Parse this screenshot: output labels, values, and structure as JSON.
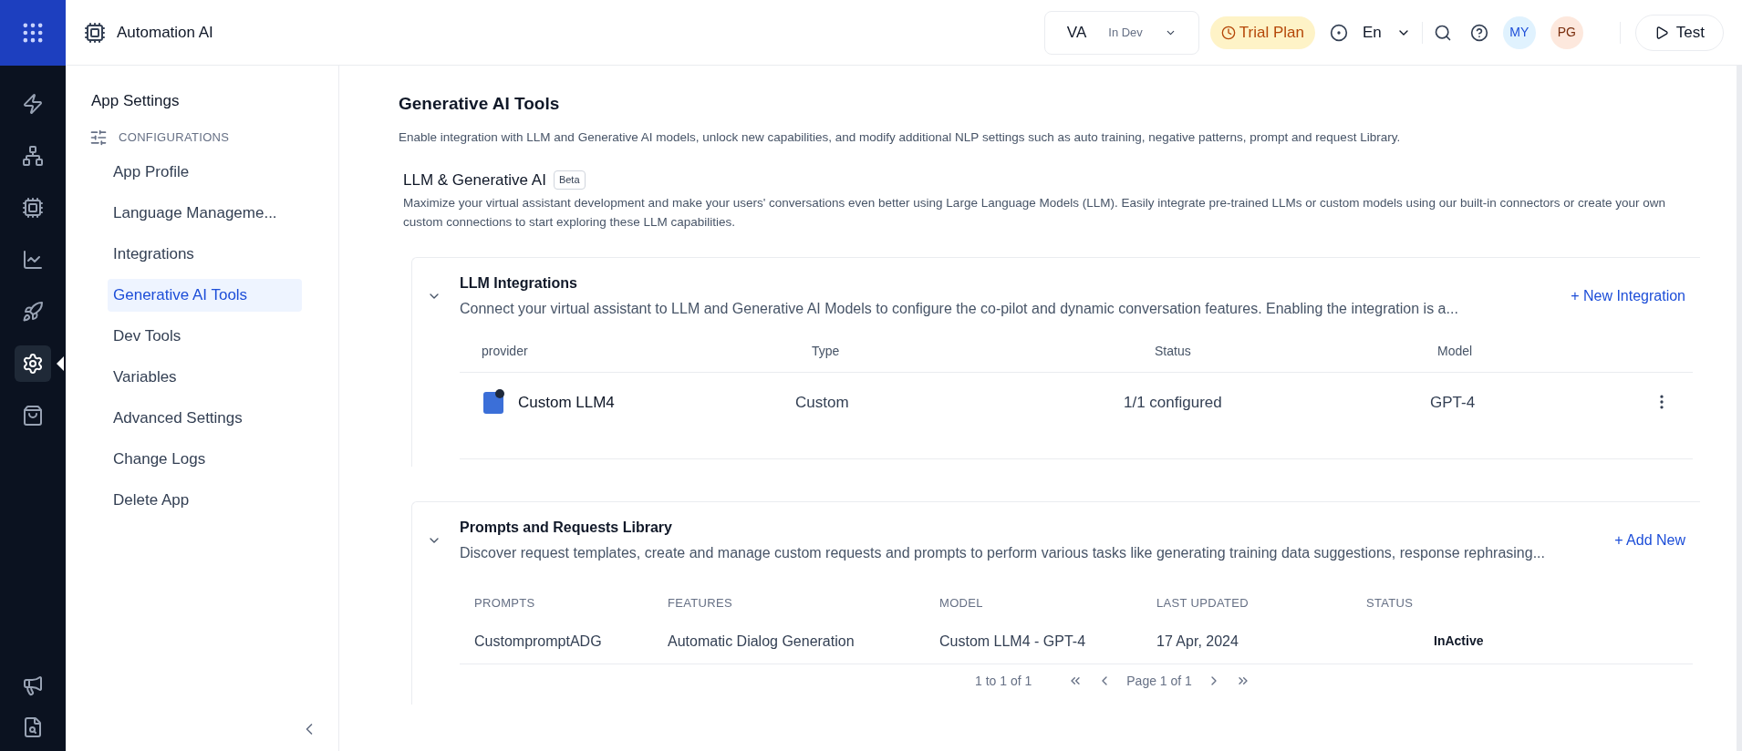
{
  "header": {
    "app_name": "Automation AI",
    "environment": {
      "code": "VA",
      "status": "In Dev"
    },
    "plan": "Trial Plan",
    "language": "En",
    "avatars": [
      "MY",
      "PG"
    ],
    "test_button": "Test"
  },
  "ribbon": [
    {
      "kind": "flows",
      "selected": false
    },
    {
      "kind": "hierarchy",
      "selected": false
    },
    {
      "kind": "chip",
      "selected": false
    },
    {
      "kind": "chart",
      "selected": false
    },
    {
      "kind": "rocket",
      "selected": false
    },
    {
      "kind": "settings",
      "selected": true
    },
    {
      "kind": "bag",
      "selected": false
    }
  ],
  "ribbon_bottom": [
    {
      "kind": "megaphone"
    },
    {
      "kind": "search-doc"
    }
  ],
  "settings": {
    "title": "App Settings",
    "section": "CONFIGURATIONS",
    "items": [
      {
        "label": "App Profile",
        "selected": false
      },
      {
        "label": "Language Manageme...",
        "selected": false
      },
      {
        "label": "Integrations",
        "selected": false
      },
      {
        "label": "Generative AI Tools",
        "selected": true
      },
      {
        "label": "Dev Tools",
        "selected": false
      },
      {
        "label": "Variables",
        "selected": false
      },
      {
        "label": "Advanced Settings",
        "selected": false
      },
      {
        "label": "Change Logs",
        "selected": false
      },
      {
        "label": "Delete App",
        "selected": false
      }
    ]
  },
  "content": {
    "title": "Generative AI Tools",
    "description": "Enable integration with LLM and Generative AI models, unlock new capabilities, and modify additional NLP settings such as auto training, negative patterns, prompt and request Library.",
    "llm": {
      "title": "LLM & Generative AI",
      "badge": "Beta",
      "description": "Maximize your virtual assistant development and make your users' conversations even better using Large Language Models (LLM). Easily integrate pre-trained LLMs or custom models using our built-in connectors or create your own custom connections to start exploring these LLM capabilities."
    },
    "integrations": {
      "title": "LLM Integrations",
      "description": "Connect your virtual assistant to LLM and Generative AI Models to configure the co-pilot and dynamic conversation features. Enabling the integration is a...",
      "action": "+ New Integration",
      "expanded": true,
      "columns": [
        "provider",
        "Type",
        "Status",
        "Model"
      ],
      "rows": [
        {
          "provider": "Custom LLM4",
          "type": "Custom",
          "status": "1/1 configured",
          "model": "GPT-4"
        }
      ]
    },
    "prompts": {
      "title": "Prompts and Requests Library",
      "description": "Discover request templates, create and manage custom requests and prompts to perform various tasks like generating training data suggestions, response rephrasing...",
      "action": "+ Add New",
      "expanded": true,
      "columns": [
        "PROMPTS",
        "FEATURES",
        "MODEL",
        "LAST UPDATED",
        "STATUS"
      ],
      "rows": [
        {
          "prompt": "CustompromptADG",
          "feature": "Automatic Dialog Generation",
          "model": "Custom LLM4 - GPT-4",
          "updated": "17 Apr, 2024",
          "status": "InActive"
        }
      ],
      "pagination": {
        "range": "1 to 1 of 1",
        "page": "Page 1 of 1"
      }
    }
  }
}
